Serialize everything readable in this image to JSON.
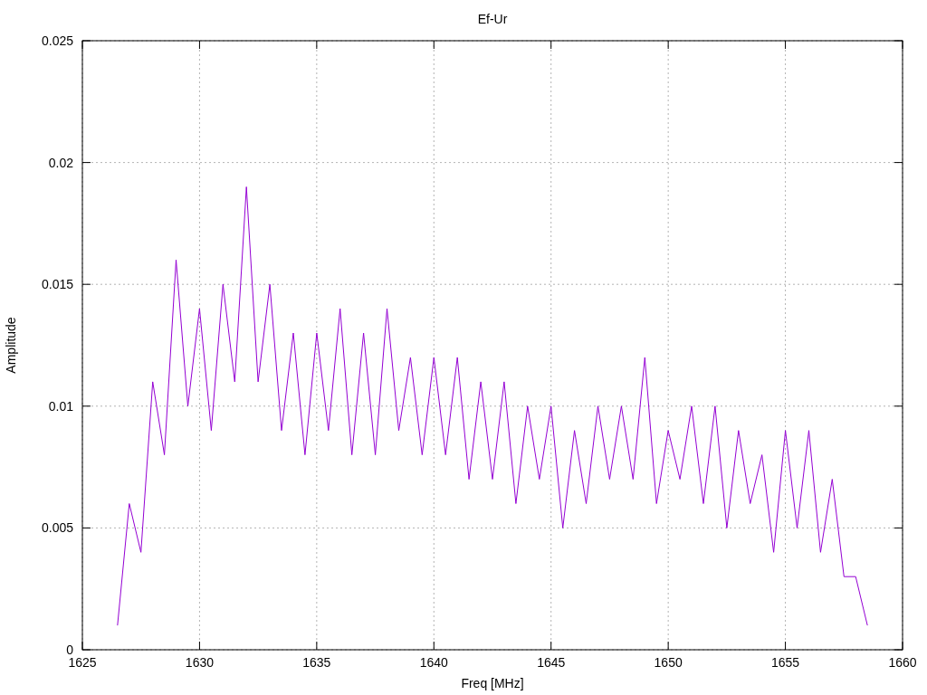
{
  "chart_data": {
    "type": "line",
    "title": "Ef-Ur",
    "xlabel": "Freq [MHz]",
    "ylabel": "Amplitude",
    "grid": true,
    "xlim": [
      1625,
      1660
    ],
    "ylim": [
      0,
      0.025
    ],
    "xticks": [
      1625,
      1630,
      1635,
      1640,
      1645,
      1650,
      1655,
      1660
    ],
    "yticks": [
      0,
      0.005,
      0.01,
      0.015,
      0.02,
      0.025
    ],
    "x": [
      1626.5,
      1627,
      1627.5,
      1628,
      1628.5,
      1629,
      1629.5,
      1630,
      1630.5,
      1631,
      1631.5,
      1632,
      1632.5,
      1633,
      1633.5,
      1634,
      1634.5,
      1635,
      1635.5,
      1636,
      1636.5,
      1637,
      1637.5,
      1638,
      1638.5,
      1639,
      1639.5,
      1640,
      1640.5,
      1641,
      1641.5,
      1642,
      1642.5,
      1643,
      1643.5,
      1644,
      1644.5,
      1645,
      1645.5,
      1646,
      1646.5,
      1647,
      1647.5,
      1648,
      1648.5,
      1649,
      1649.5,
      1650,
      1650.5,
      1651,
      1651.5,
      1652,
      1652.5,
      1653,
      1653.5,
      1654,
      1654.5,
      1655,
      1655.5,
      1656,
      1656.5,
      1657,
      1657.5,
      1658,
      1658.5
    ],
    "series": [
      {
        "color": "#9400d3",
        "values": [
          0.001,
          0.006,
          0.004,
          0.011,
          0.008,
          0.016,
          0.01,
          0.014,
          0.009,
          0.015,
          0.011,
          0.019,
          0.011,
          0.015,
          0.009,
          0.013,
          0.008,
          0.013,
          0.009,
          0.014,
          0.008,
          0.013,
          0.008,
          0.014,
          0.009,
          0.012,
          0.008,
          0.012,
          0.008,
          0.012,
          0.007,
          0.011,
          0.007,
          0.011,
          0.006,
          0.01,
          0.007,
          0.01,
          0.005,
          0.009,
          0.006,
          0.01,
          0.007,
          0.01,
          0.007,
          0.012,
          0.006,
          0.009,
          0.007,
          0.01,
          0.006,
          0.01,
          0.005,
          0.009,
          0.006,
          0.008,
          0.004,
          0.009,
          0.005,
          0.009,
          0.004,
          0.007,
          0.003,
          0.003,
          0.001
        ]
      }
    ]
  }
}
